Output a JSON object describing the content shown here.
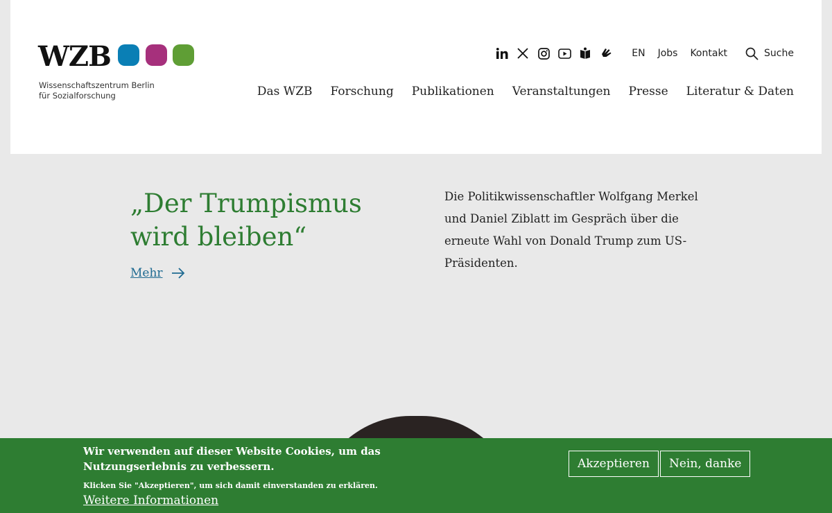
{
  "logo": {
    "word": "WZB",
    "subtitle_line1": "Wissenschaftszentrum Berlin",
    "subtitle_line2": "für Sozialforschung",
    "dot_colors": [
      "#0a7fb5",
      "#a6307c",
      "#5f9e35"
    ]
  },
  "social": [
    "linkedin-icon",
    "x-icon",
    "instagram-icon",
    "youtube-icon",
    "easy-language-icon",
    "sign-language-icon"
  ],
  "utility": {
    "lang": "EN",
    "jobs": "Jobs",
    "contact": "Kontakt",
    "search": "Suche"
  },
  "nav": [
    "Das WZB",
    "Forschung",
    "Publikationen",
    "Veranstaltungen",
    "Presse",
    "Literatur & Daten"
  ],
  "hero": {
    "title": "„Der Trumpismus wird bleiben“",
    "more": "Mehr",
    "text": "Die Politikwissenschaftler Wolfgang Merkel und Daniel Ziblatt im Gespräch über die erneute Wahl von Donald Trump zum US-Präsidenten."
  },
  "cookie": {
    "main": "Wir verwenden auf dieser Website Cookies, um das Nutzungserlebnis zu verbessern.",
    "sub": "Klicken Sie \"Akzeptieren\", um sich damit einverstanden zu erklären.",
    "more": "Weitere Informationen",
    "accept": "Akzeptieren",
    "decline": "Nein, danke"
  },
  "colors": {
    "accent_green": "#2e7d32",
    "link_blue": "#1f6a91",
    "background": "#e9e9e9"
  }
}
